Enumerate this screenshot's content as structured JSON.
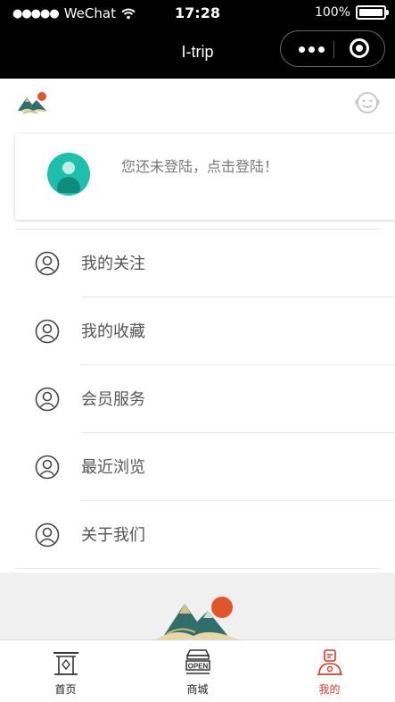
{
  "status_bar": {
    "carrier": "WeChat",
    "time": "17:28",
    "battery": "100%"
  },
  "nav": {
    "title": "I-trip"
  },
  "login": {
    "prompt": "您还未登陆，点击登陆！"
  },
  "menu": {
    "items": [
      {
        "label": "我的关注",
        "icon": "user-circle-icon"
      },
      {
        "label": "我的收藏",
        "icon": "user-circle-icon"
      },
      {
        "label": "会员服务",
        "icon": "user-circle-icon"
      },
      {
        "label": "最近浏览",
        "icon": "user-circle-icon"
      },
      {
        "label": "关于我们",
        "icon": "user-circle-icon"
      }
    ]
  },
  "tabs": [
    {
      "label": "首页",
      "icon": "home-gate-icon",
      "active": false
    },
    {
      "label": "商城",
      "icon": "shop-open-icon",
      "active": false
    },
    {
      "label": "我的",
      "icon": "profile-icon",
      "active": true
    }
  ],
  "colors": {
    "accent": "#d93a2b",
    "avatar": "#1fbfae",
    "header": "#000000"
  }
}
